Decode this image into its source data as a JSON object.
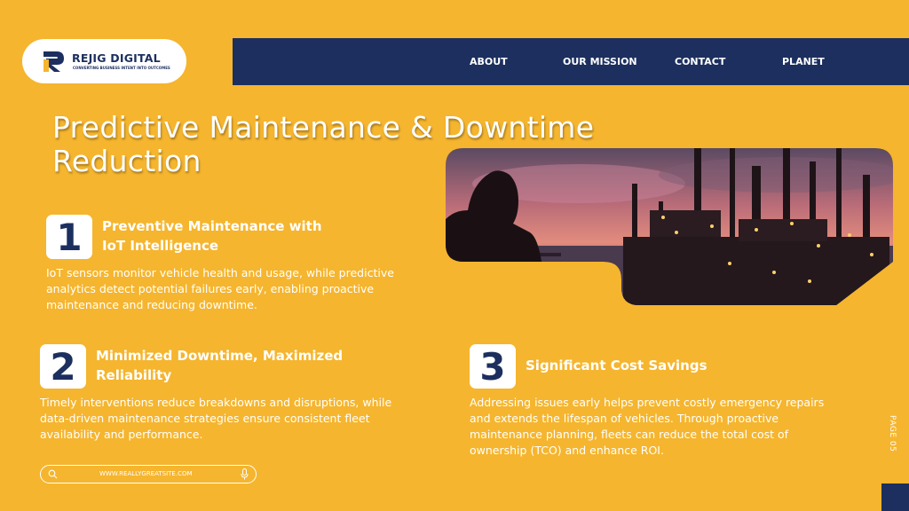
{
  "brand": {
    "name": "REJIG DIGITAL",
    "tagline": "CONVERTING BUSINESS INTENT INTO OUTCOMES"
  },
  "nav": {
    "items": [
      {
        "label": "ABOUT"
      },
      {
        "label": "OUR MISSION"
      },
      {
        "label": "CONTACT"
      },
      {
        "label": "PLANET"
      }
    ]
  },
  "title": "Predictive Maintenance & Downtime Reduction",
  "sections": [
    {
      "number": "1",
      "heading": "Preventive Maintenance with IoT Intelligence",
      "body": "IoT sensors monitor vehicle health and usage, while predictive analytics detect potential failures early, enabling proactive maintenance and reducing downtime."
    },
    {
      "number": "2",
      "heading": "Minimized Downtime, Maximized Reliability",
      "body": "Timely interventions reduce breakdowns and disruptions, while data-driven maintenance strategies ensure consistent fleet availability and performance."
    },
    {
      "number": "3",
      "heading": "Significant Cost Savings",
      "body": "Addressing issues early helps prevent costly emergency repairs and extends the lifespan of vehicles. Through proactive maintenance planning, fleets can reduce the total cost of ownership (TCO) and enhance ROI."
    }
  ],
  "search": {
    "value": "WWW.REALLYGREATSITE.COM",
    "icon": "search-icon",
    "mic_icon": "microphone-icon"
  },
  "page_label": "PAGE 05",
  "colors": {
    "background": "#F5B52E",
    "navy": "#1C2F5E",
    "white": "#FFFFFF"
  }
}
